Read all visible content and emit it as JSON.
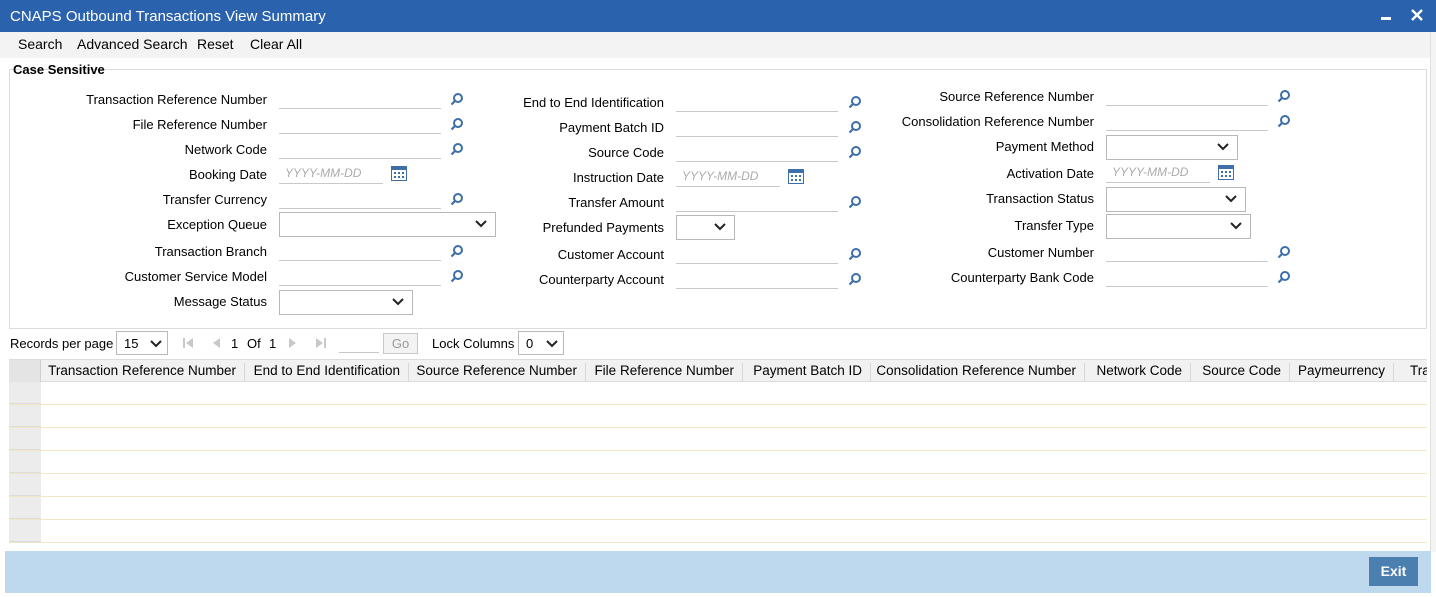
{
  "window": {
    "title": "CNAPS Outbound Transactions View Summary",
    "minimize_glyph": "▬",
    "close_glyph": "✕"
  },
  "toolbar": {
    "search": "Search",
    "advanced_search": "Advanced Search",
    "reset": "Reset",
    "clear_all": "Clear All"
  },
  "criteria": {
    "case_sensitive": "Case Sensitive",
    "col1": {
      "transaction_reference_number": "Transaction Reference Number",
      "file_reference_number": "File Reference Number",
      "network_code": "Network Code",
      "booking_date": "Booking Date",
      "transfer_currency": "Transfer Currency",
      "exception_queue": "Exception Queue",
      "transaction_branch": "Transaction Branch",
      "customer_service_model": "Customer Service Model",
      "message_status": "Message Status"
    },
    "col2": {
      "end_to_end_identification": "End to End Identification",
      "payment_batch_id": "Payment Batch ID",
      "source_code": "Source Code",
      "instruction_date": "Instruction Date",
      "transfer_amount": "Transfer Amount",
      "prefunded_payments": "Prefunded Payments",
      "customer_account": "Customer Account",
      "counterparty_account": "Counterparty Account"
    },
    "col3": {
      "source_reference_number": "Source Reference Number",
      "consolidation_reference_number": "Consolidation Reference Number",
      "payment_method": "Payment Method",
      "activation_date": "Activation Date",
      "transaction_status": "Transaction Status",
      "transfer_type": "Transfer Type",
      "customer_number": "Customer Number",
      "counterparty_bank_code": "Counterparty Bank Code"
    },
    "date_placeholder": "YYYY-MM-DD"
  },
  "pager": {
    "records_per_page_label": "Records per page",
    "records_per_page_value": "15",
    "current_page": "1",
    "of_label": "Of",
    "total_pages": "1",
    "go_label": "Go",
    "lock_columns_label": "Lock Columns",
    "lock_columns_value": "0"
  },
  "grid": {
    "columns": [
      "Transaction Reference Number",
      "End to End Identification",
      "Source Reference Number",
      "File Reference Number",
      "Payment Batch ID",
      "Consolidation Reference Number",
      "Network Code",
      "Source Code",
      "Paymeurrency",
      "Tra"
    ]
  },
  "footer": {
    "exit": "Exit"
  },
  "colors": {
    "title_bar": "#2b62ad",
    "footer": "#bed8ee",
    "exit_button": "#4a7fb0",
    "icon_blue": "#3e6fa8"
  }
}
